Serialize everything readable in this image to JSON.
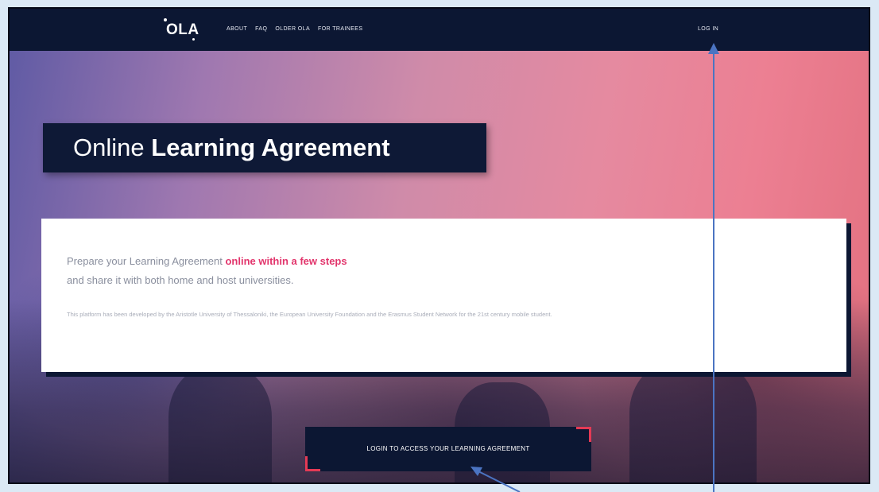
{
  "header": {
    "logo": "OLA",
    "nav": [
      "ABOUT",
      "FAQ",
      "OLDER OLA",
      "FOR TRAINEES"
    ],
    "login": "LOG IN"
  },
  "hero": {
    "title_light": "Online ",
    "title_bold": "Learning Agreement"
  },
  "card": {
    "intro_part1": "Prepare your Learning Agreement ",
    "intro_highlight": "online within a few steps",
    "intro_part2": "and share it with both home and host universities.",
    "credits": "This platform has been developed by the Aristotle University of Thessaloniki, the European University Foundation and the Erasmus Student Network for the 21st century mobile student."
  },
  "cta": {
    "label": "LOGIN TO ACCESS YOUR LEARNING AGREEMENT"
  },
  "colors": {
    "navy": "#0c1733",
    "accent": "#e2356c",
    "arrow": "#4b74c2"
  }
}
